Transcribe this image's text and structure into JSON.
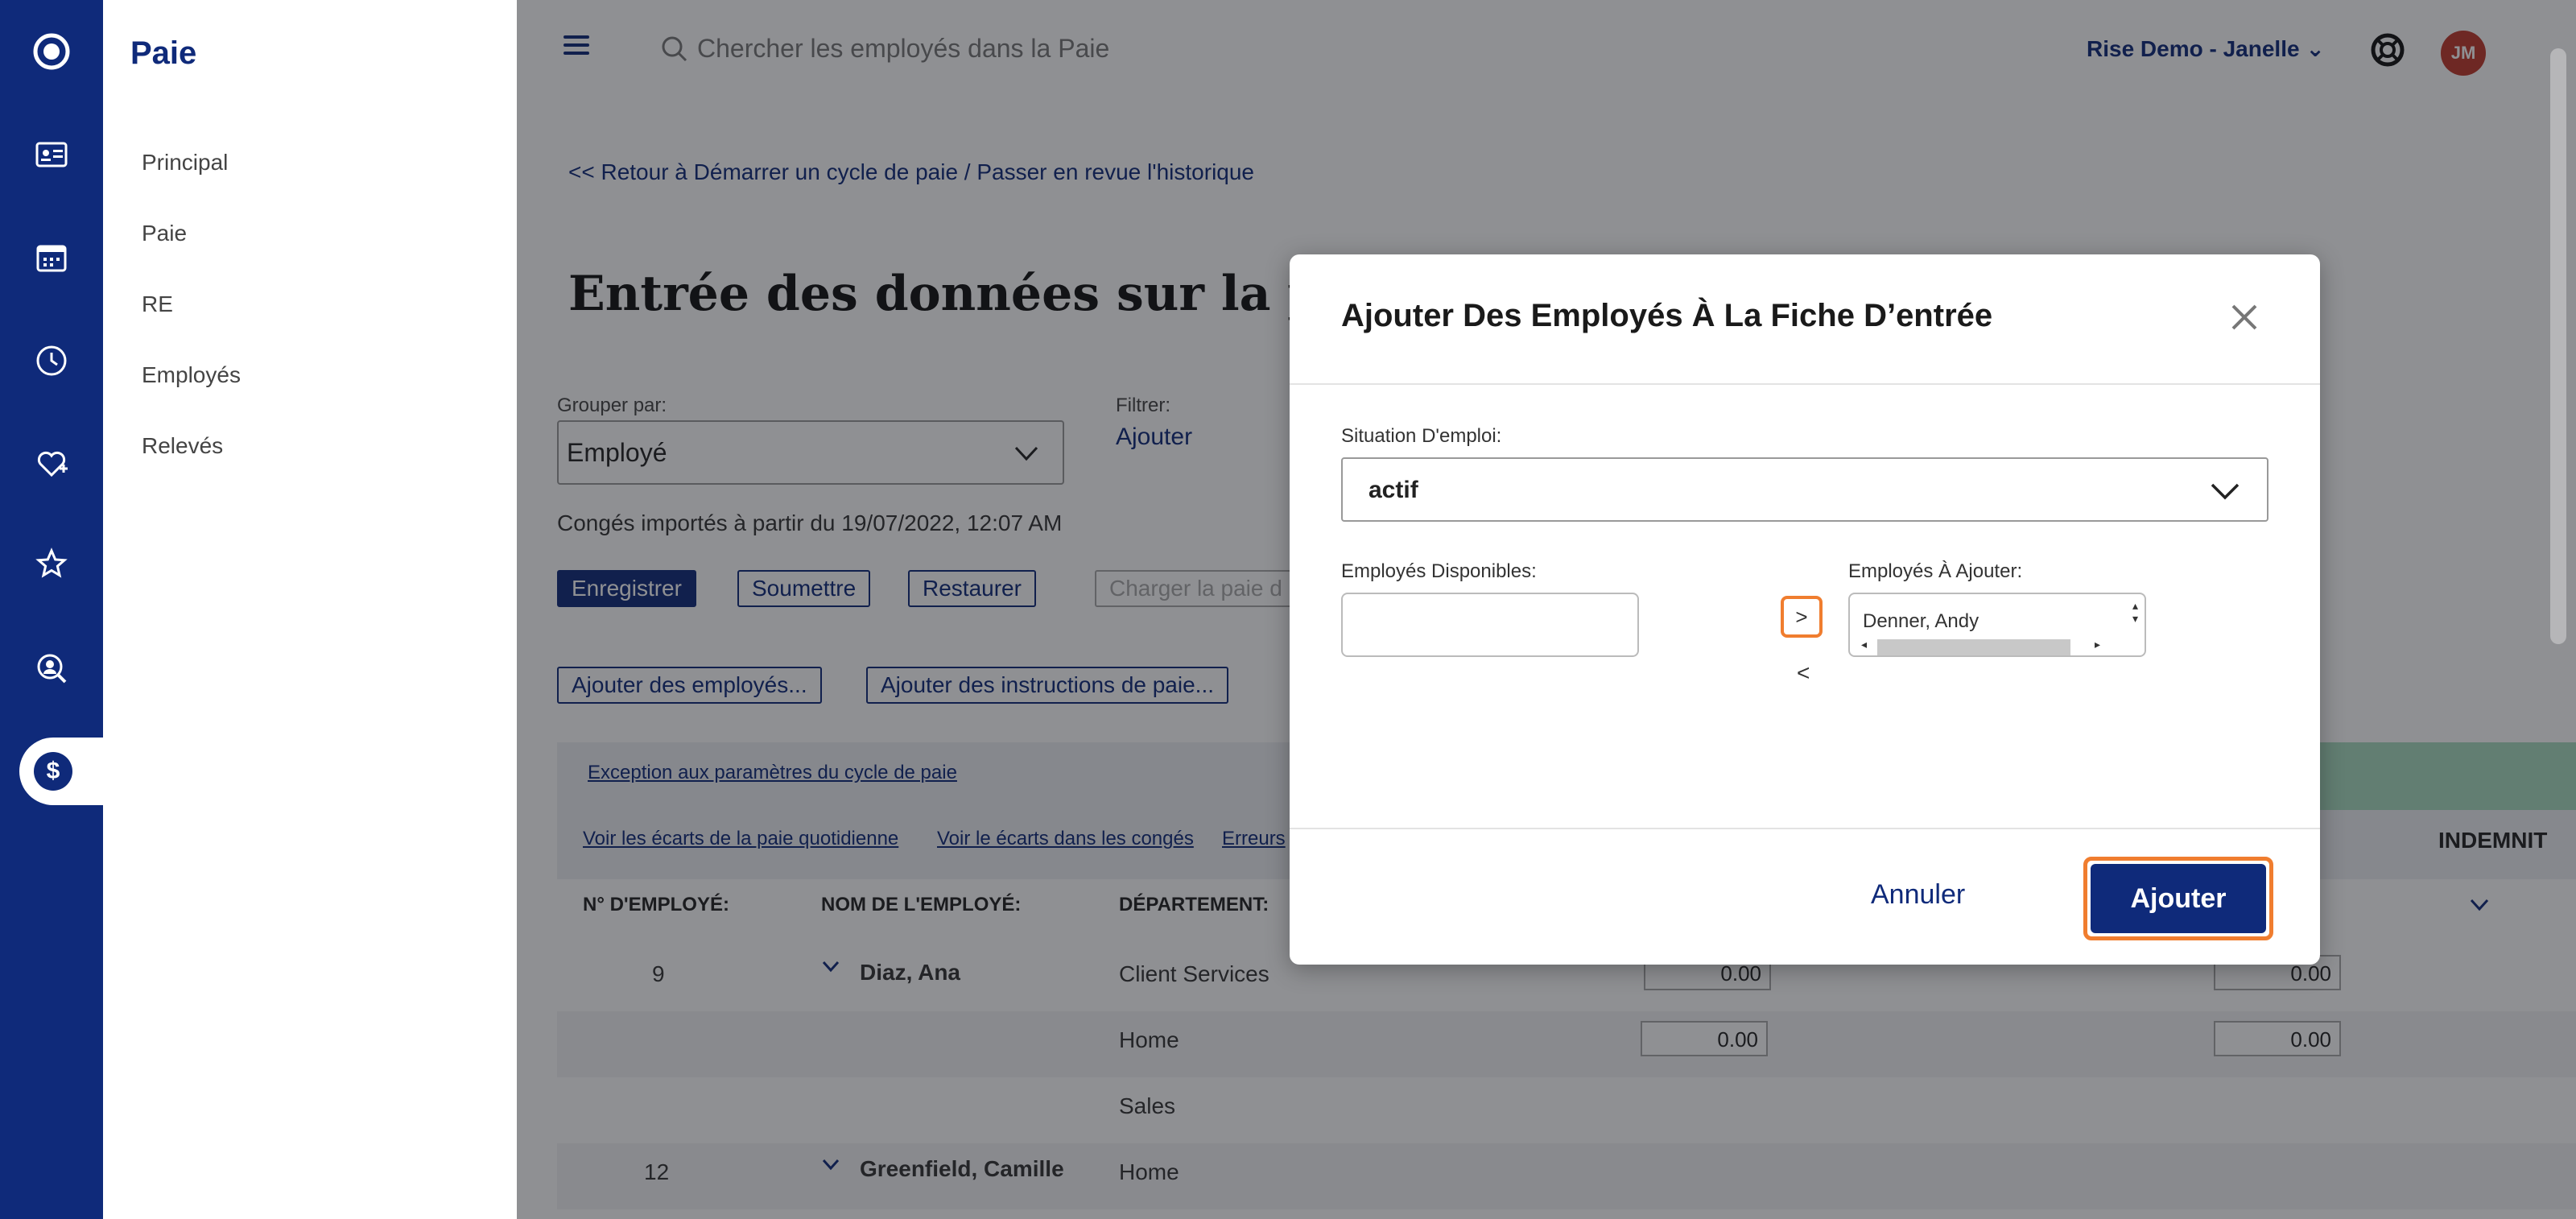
{
  "app": {
    "section_title": "Paie",
    "nav_items": [
      "Principal",
      "Paie",
      "RE",
      "Employés",
      "Relevés"
    ],
    "rail_icons": [
      "logo-icon",
      "id-card-icon",
      "calendar-icon",
      "clock-icon",
      "heart-plus-icon",
      "star-icon",
      "person-search-icon",
      "dollar-icon"
    ]
  },
  "topbar": {
    "search_placeholder": "Chercher les employés dans la Paie",
    "user_label": "Rise Demo - Janelle",
    "avatar_initials": "JM"
  },
  "page": {
    "back_link": "<< Retour à Démarrer un cycle de paie / Passer en revue l'historique",
    "title": "Entrée des données sur la paie",
    "groupby_label": "Grouper par:",
    "groupby_value": "Employé",
    "filter_label": "Filtrer:",
    "filter_value": "Ajouter",
    "conges_note": "Congés importés à partir du 19/07/2022, 12:07 AM",
    "buttons": {
      "save": "Enregistrer",
      "submit": "Soumettre",
      "restore": "Restaurer",
      "load": "Charger la paie d",
      "add_employees": "Ajouter des employés...",
      "add_instructions": "Ajouter des instructions de paie..."
    },
    "grid": {
      "exception_link": "Exception aux paramètres du cycle de paie",
      "links": [
        "Voir les écarts de la paie quotidienne",
        "Voir le écarts dans les congés",
        "Erreurs"
      ],
      "col_emp_no": "N° D'EMPLOYÉ:",
      "col_name": "NOM DE L'EMPLOYÉ:",
      "col_dept": "DÉPARTEMENT:",
      "col_indemn": "INDEMNIT",
      "rows": [
        {
          "emp_no": "9",
          "name": "Diaz, Ana",
          "dept": "Client Services",
          "v1": "0.00",
          "v2": "0.00"
        },
        {
          "emp_no": "",
          "name": "",
          "dept": "Home",
          "v1": "0.00",
          "v2": "0.00"
        },
        {
          "emp_no": "",
          "name": "",
          "dept": "Sales",
          "v1": "",
          "v2": ""
        },
        {
          "emp_no": "12",
          "name": "Greenfield, Camille",
          "dept": "Home",
          "v1": "",
          "v2": ""
        }
      ]
    }
  },
  "modal": {
    "title": "Ajouter Des Employés À La Fiche D’entrée",
    "status_label": "Situation D'emploi:",
    "status_value": "actif",
    "available_label": "Employés Disponibles:",
    "to_add_label": "Employés À Ajouter:",
    "to_add_items": [
      "Denner, Andy"
    ],
    "move_right": ">",
    "move_left": "<",
    "cancel": "Annuler",
    "add": "Ajouter"
  },
  "colors": {
    "brand": "#0f2a7a",
    "highlight": "#f07d2f",
    "avatar": "#c0392b",
    "green_band": "#a9dcc0"
  }
}
